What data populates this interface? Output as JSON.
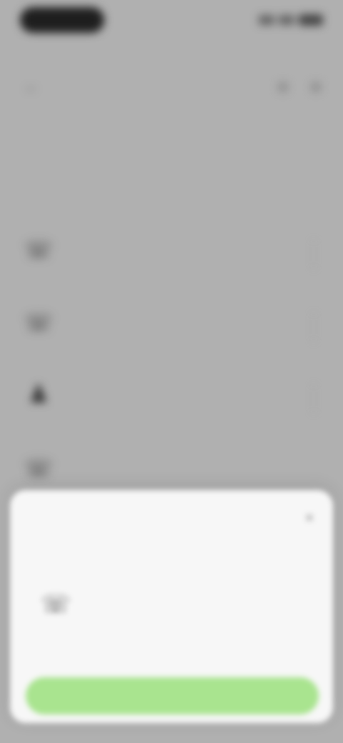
{
  "status_bar": {
    "time": "",
    "icons": [
      "signal-icon",
      "wifi-icon",
      "battery-icon"
    ]
  },
  "nav": {
    "back_icon": "arrow-left-icon",
    "title": "",
    "actions": [
      "search-icon",
      "more-icon"
    ]
  },
  "description": "",
  "section": {
    "title": ""
  },
  "list": [
    {
      "icon": "phone-icon",
      "title": "",
      "subtitle": "",
      "subtitle2": ""
    },
    {
      "icon": "phone-icon",
      "title": "",
      "subtitle": "",
      "subtitle2": ""
    },
    {
      "icon": "person-icon",
      "title": "",
      "subtitle": "",
      "subtitle2": ""
    },
    {
      "icon": "phone-icon",
      "title": "",
      "subtitle": "",
      "subtitle2": ""
    }
  ],
  "sheet": {
    "title": "",
    "close_icon": "close-icon",
    "item": {
      "icon": "phone-icon",
      "title": "",
      "subtitle": ""
    },
    "button_label": ""
  },
  "colors": {
    "accent": "#a9e48f",
    "sheet_bg": "#f7f7f7",
    "overlay": "#b0b0b0"
  }
}
